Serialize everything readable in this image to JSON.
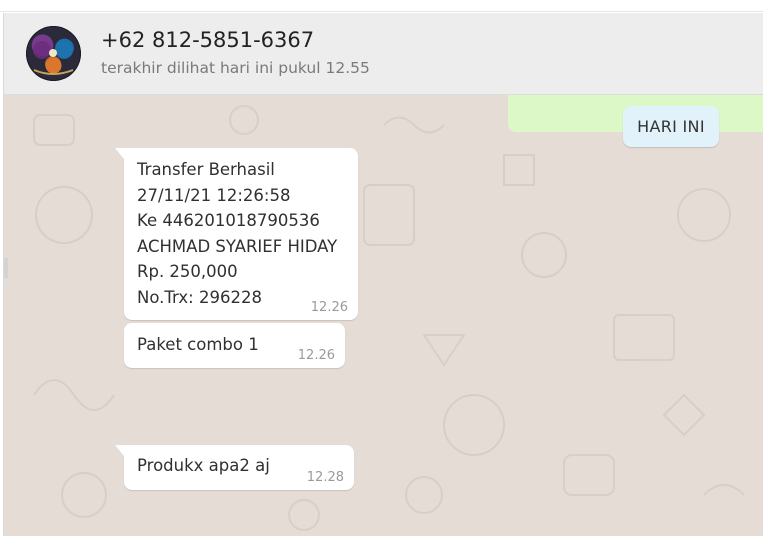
{
  "contact": {
    "name": "+62 812-5851-6367",
    "status": "terakhir dilihat hari ini pukul 12.55",
    "avatar_icon": "contact-avatar"
  },
  "chat": {
    "date_label": "HARI INI",
    "messages": [
      {
        "text": "Transfer Berhasil\n27/11/21 12:26:58\nKe 446201018790536\nACHMAD SYARIEF HIDAY\nRp. 250,000\nNo.Trx: 296228",
        "time": "12.26"
      },
      {
        "text": "Paket combo 1",
        "time": "12.26"
      },
      {
        "text": "Produkx apa2 aj",
        "time": "12.28"
      }
    ]
  },
  "colors": {
    "header_bg": "#ededed",
    "chat_bg": "#e5ddd5",
    "outgoing_bubble": "#dcf8c6",
    "incoming_bubble": "#ffffff",
    "date_pill": "#e1f2fb"
  }
}
